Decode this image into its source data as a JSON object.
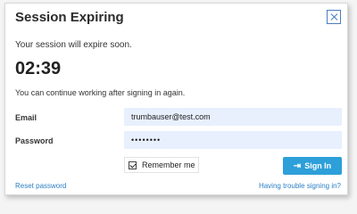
{
  "dialog": {
    "title": "Session Expiring",
    "message": "Your session will expire soon.",
    "countdown": "02:39",
    "instruction": "You can continue working after signing in again."
  },
  "form": {
    "email_label": "Email",
    "email_value": "trumbauser@test.com",
    "password_label": "Password",
    "password_value": "••••••••",
    "remember_label": "Remember me",
    "remember_checked": true,
    "signin_label": "Sign In",
    "signin_icon": "sign-in-icon"
  },
  "links": {
    "reset": "Reset password",
    "trouble": "Having trouble signing in?"
  },
  "colors": {
    "accent": "#2d9fd9",
    "link": "#2a7fc4",
    "input_bg": "#e8f0fe"
  }
}
